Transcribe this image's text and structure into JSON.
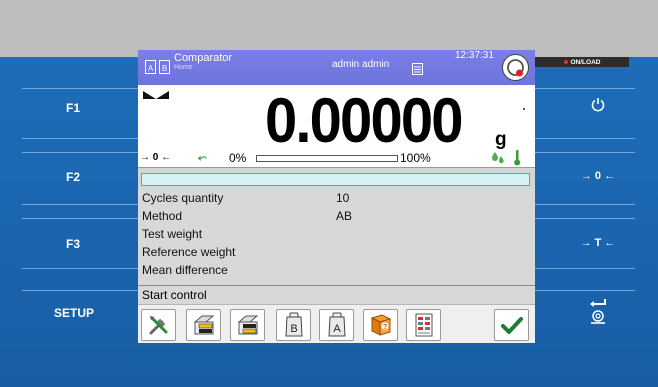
{
  "device": {
    "on_load_label": "ON/LOAD",
    "left_keys": [
      "F1",
      "F2",
      "F3",
      "SETUP"
    ],
    "right_keys": {
      "power": "⏻",
      "zero": "→ 0 ←",
      "tare": "→ T ←"
    }
  },
  "header": {
    "title": "Comparator",
    "subtitle": "Home",
    "user": "admin admin",
    "time": "12:37:31",
    "method_letters": [
      "A",
      "B"
    ]
  },
  "weighing": {
    "value": "0.00000",
    "unit": "g",
    "zero_indicator": "→ 0 ←",
    "range_start": "0%",
    "range_end": "100%",
    "fill_fraction": 0
  },
  "params": [
    {
      "label": "Cycles quantity",
      "value": "10"
    },
    {
      "label": "Method",
      "value": "AB"
    },
    {
      "label": "Test weight",
      "value": ""
    },
    {
      "label": "Reference weight",
      "value": ""
    },
    {
      "label": "Mean difference",
      "value": ""
    }
  ],
  "start_label": "Start control",
  "toolbar": [
    {
      "name": "settings-button",
      "icon": "tools-icon"
    },
    {
      "name": "printout-header-button",
      "icon": "printer-header-icon"
    },
    {
      "name": "printout-footer-button",
      "icon": "printer-footer-icon"
    },
    {
      "name": "weight-b-button",
      "icon": "weight-b-icon",
      "letter": "B"
    },
    {
      "name": "weight-a-button",
      "icon": "weight-a-icon",
      "letter": "A"
    },
    {
      "name": "help-button",
      "icon": "help-book-icon"
    },
    {
      "name": "report-button",
      "icon": "report-icon"
    },
    {
      "name": "confirm-button",
      "icon": "checkmark-icon"
    }
  ],
  "colors": {
    "panel": "#1a64ad",
    "header": "#7377df",
    "progress": "#d5f3f3",
    "accent_green": "#2c9a3a"
  }
}
